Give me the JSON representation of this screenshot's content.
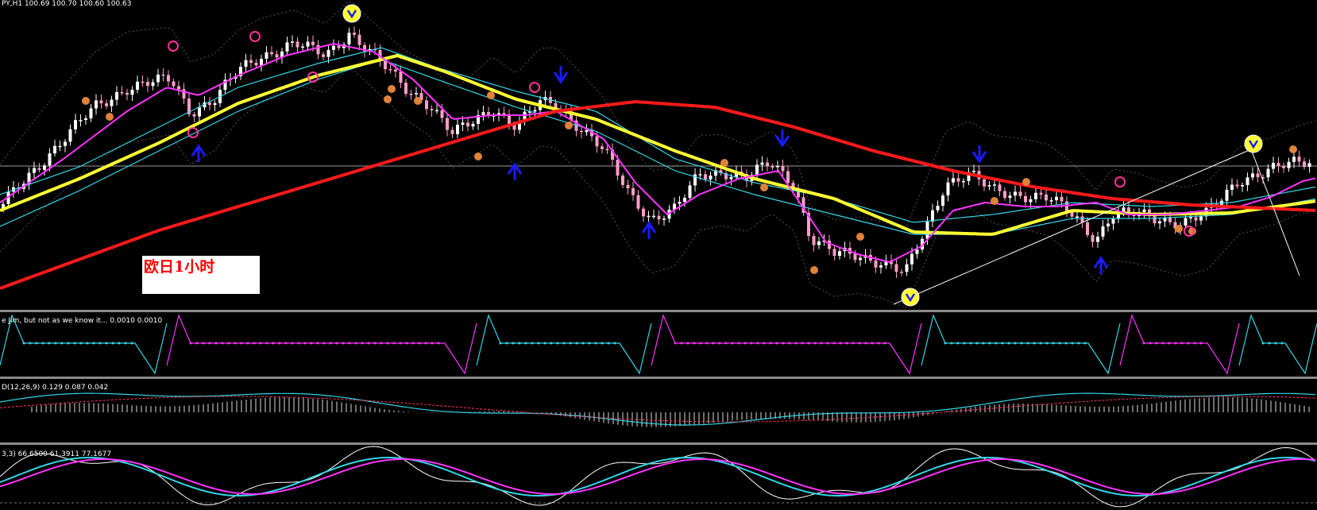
{
  "window": {
    "symbol_header": "PY,H1  100.69 100.70 100.60 100.63"
  },
  "annotation": {
    "label": "欧日1小时",
    "label_color": "#ff0000",
    "label_bg": "#ffffff"
  },
  "indicators": {
    "panel1_header": "e Jim, but not as we know it...  0.0010 0.0010",
    "panel2_header": "D(12,26,9) 0.129 0.087 0.042",
    "panel3_header": "3,3) 66.6500 61.3911 77.1677"
  },
  "colors": {
    "background": "#000000",
    "bull_candle": "#ffffff",
    "bear_candle": "#ff9ec8",
    "ma_red": "#ff1a1a",
    "ma_yellow": "#ffff33",
    "ma_magenta": "#ff33ff",
    "ma_cyan": "#33d6e6",
    "signal_blue": "#1a1aff",
    "signal_orange": "#e0823a",
    "separator": "#a0a0a0"
  },
  "chart_data": {
    "type": "line",
    "description_series": [
      {
        "name": "",
        "role": "price"
      }
    ]
  }
}
